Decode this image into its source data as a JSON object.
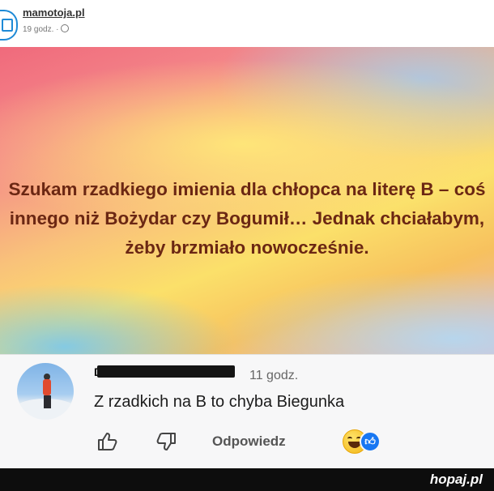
{
  "post": {
    "page_name": "mamotoja.pl",
    "time": "19 godz. ·",
    "banner_text": "Szukam rzadkiego imienia dla chłopca na literę B – coś innego niż Bożydar czy Bogumił… Jednak chciałabym, żeby brzmiało nowocześnie."
  },
  "comment": {
    "author": "D",
    "time": "11 godz.",
    "text": "Z rzadkich na B to chyba Biegunka",
    "reply_label": "Odpowiedz"
  },
  "watermark": "hopaj.pl",
  "icons": {
    "like": "thumbs-up-icon",
    "dislike": "thumbs-down-icon",
    "reactions": [
      "laughing-emoji-icon",
      "like-reaction-icon"
    ]
  },
  "colors": {
    "banner_text": "#6b2713",
    "page_link": "#333333",
    "like_blue": "#1877f2"
  }
}
